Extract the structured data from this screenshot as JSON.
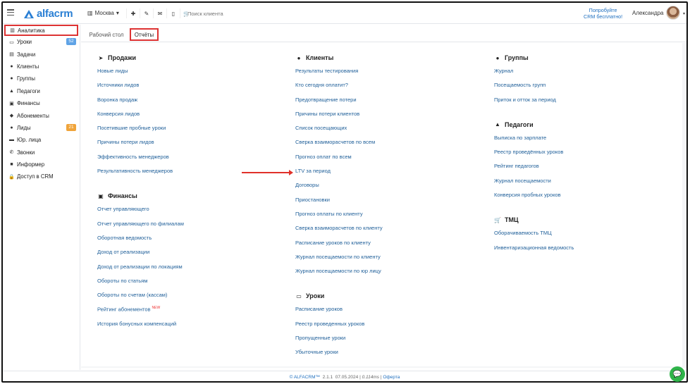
{
  "header": {
    "logo": "alfacrm",
    "branch": "Москва",
    "search_placeholder": "Поиск клиента",
    "try_crm_line1": "Попробуйте",
    "try_crm_line2": "CRM бесплатно!",
    "user_name": "Александра",
    "icons": [
      "plus-icon",
      "wrench-icon",
      "mail-icon",
      "phone-icon",
      "cart-icon",
      "bell-icon"
    ]
  },
  "sidebar": {
    "items": [
      {
        "label": "Аналитика",
        "icon": "chart-icon",
        "active": true
      },
      {
        "label": "Уроки",
        "icon": "calendar-icon",
        "badge": "52"
      },
      {
        "label": "Задачи",
        "icon": "task-icon"
      },
      {
        "label": "Клиенты",
        "icon": "user-icon"
      },
      {
        "label": "Группы",
        "icon": "users-icon"
      },
      {
        "label": "Педагоги",
        "icon": "graduation-icon"
      },
      {
        "label": "Финансы",
        "icon": "money-icon"
      },
      {
        "label": "Абонементы",
        "icon": "tag-icon"
      },
      {
        "label": "Лиды",
        "icon": "lead-icon",
        "badge": "21"
      },
      {
        "label": "Юр. лица",
        "icon": "briefcase-icon"
      },
      {
        "label": "Звонки",
        "icon": "phone-icon"
      },
      {
        "label": "Информер",
        "icon": "informer-icon"
      },
      {
        "label": "Доступ в CRM",
        "icon": "lock-icon"
      }
    ]
  },
  "tabs": [
    {
      "label": "Рабочий стол"
    },
    {
      "label": "Отчёты",
      "active": true
    }
  ],
  "columns": {
    "col1": [
      {
        "title": "Продажи",
        "icon": "rocket-icon",
        "links": [
          "Новые лиды",
          "Источники лидов",
          "Воронка продаж",
          "Конверсия лидов",
          "Посетившие пробные уроки",
          "Причины потери лидов",
          "Эффективность менеджеров",
          "Результативность менеджеров"
        ]
      },
      {
        "title": "Финансы",
        "icon": "money-icon",
        "links": [
          "Отчет управляющего",
          "Отчет управляющего по филиалам",
          "Оборотная ведомость",
          "Доход от реализации",
          "Доход от реализации по локациям",
          "Обороты по статьям",
          "Обороты по счетам (кассам)",
          "Рейтинг абонементов",
          "История бонусных компенсаций"
        ]
      }
    ],
    "col2": [
      {
        "title": "Клиенты",
        "icon": "user-icon",
        "links": [
          "Результаты тестирования",
          "Кто сегодня оплатит?",
          "Предотвращение потери",
          "Причины потери клиентов",
          "Список посещающих",
          "Сверка взаиморасчетов по всем",
          "Прогноз оплат по всем",
          "LTV за период",
          "Договоры",
          "Приостановки",
          "Прогноз оплаты по клиенту",
          "Сверка взаиморасчетов по клиенту",
          "Расписание уроков по клиенту",
          "Журнал посещаемости по клиенту",
          "Журнал посещаемости по юр лицу"
        ]
      },
      {
        "title": "Уроки",
        "icon": "calendar-icon",
        "links": [
          "Расписание уроков",
          "Реестр проведенных уроков",
          "Пропущенные уроки",
          "Убыточные уроки"
        ]
      }
    ],
    "col3": [
      {
        "title": "Группы",
        "icon": "users-icon",
        "links": [
          "Журнал",
          "Посещаемость групп",
          "Приток и отток за период"
        ]
      },
      {
        "title": "Педагоги",
        "icon": "graduation-icon",
        "links": [
          "Выписка по зарплате",
          "Реестр проведённых уроков",
          "Рейтинг педагогов",
          "Журнал посещаемости",
          "Конверсия пробных уроков"
        ]
      },
      {
        "title": "ТМЦ",
        "icon": "cart-icon",
        "links": [
          "Оборачиваемость ТМЦ",
          "Инвентаризационная ведомость"
        ]
      }
    ],
    "new_tag": "NEW"
  },
  "footer": {
    "brand": "© ALFACRM™",
    "version": "2.1.1",
    "date": "07.05.2024",
    "timing": "0.114ms",
    "offer": "Оферта"
  }
}
